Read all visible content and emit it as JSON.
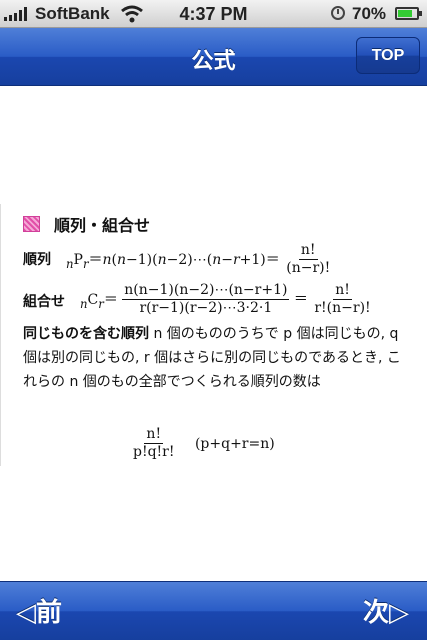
{
  "status_bar": {
    "carrier": "SoftBank",
    "time": "4:37 PM",
    "battery": "70%"
  },
  "nav": {
    "title": "公式",
    "top_button": "TOP"
  },
  "section": {
    "title": "順列・組合せ"
  },
  "permutation": {
    "label": "順列",
    "formula": "nPr = n(n−1)(n−2)⋯(n−r+1) = n!/(n−r)!",
    "numerator": "n!",
    "denominator": "(n−r)!"
  },
  "combination": {
    "label": "組合せ",
    "lhs": "nCr",
    "frac1_num": "n(n−1)(n−2)⋯(n−r+1)",
    "frac1_den": "r(r−1)(r−2)⋯3·2·1",
    "frac2_num": "n!",
    "frac2_den": "r!(n−r)!"
  },
  "multiset": {
    "label": "同じものを含む順列",
    "text": "n 個のもののうちで p 個は同じもの, q 個は別の同じもの, r 個はさらに別の同じものであるとき, これらの n 個のもの全部でつくられる順列の数は",
    "numerator": "n!",
    "denominator": "p!q!r!",
    "condition": "(p+q+r=n)"
  },
  "toolbar": {
    "prev": "◁前",
    "next": "次▷"
  }
}
